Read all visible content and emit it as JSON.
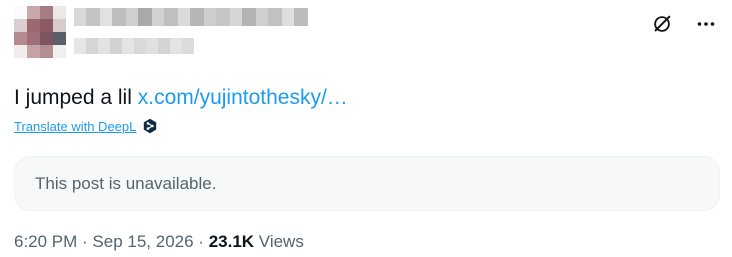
{
  "tweet": {
    "text_prefix": "I jumped a lil ",
    "link_text": "x.com/yujintothesky/…",
    "translate_label": "Translate with DeepL",
    "quoted_post_status": "This post is unavailable.",
    "time": "6:20 PM",
    "separator_1": " · ",
    "date": "Sep 15, 2026",
    "separator_2": " · ",
    "views_count": "23.1K",
    "views_label": " Views"
  },
  "icons": {
    "grok": "grok-icon",
    "more": "more-icon",
    "deepl": "deepl-icon"
  },
  "colors": {
    "link": "#1d9bf0",
    "text": "#0f1419",
    "secondary": "#536471",
    "card_bg": "#f7f9f9"
  }
}
